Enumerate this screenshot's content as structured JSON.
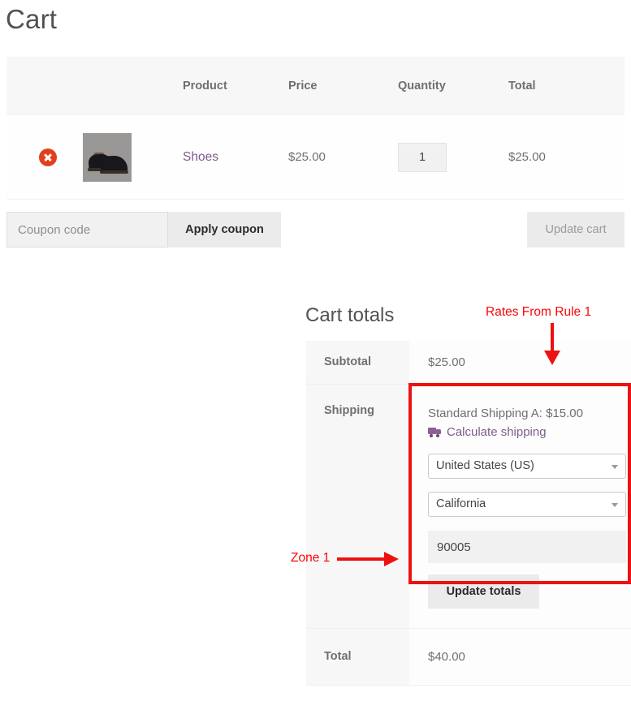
{
  "page": {
    "title": "Cart"
  },
  "cart_table": {
    "columns": [
      "",
      "",
      "Product",
      "Price",
      "Quantity",
      "Total"
    ],
    "headers": {
      "product": "Product",
      "price": "Price",
      "quantity": "Quantity",
      "total": "Total"
    },
    "rows": [
      {
        "remove_icon": "remove-circle-icon",
        "thumbnail": "product-thumbnail-shoes",
        "name": "Shoes",
        "price": "$25.00",
        "quantity": "1",
        "total": "$25.00"
      }
    ]
  },
  "coupon": {
    "placeholder": "Coupon code",
    "value": "",
    "apply_label": "Apply coupon",
    "update_cart_label": "Update cart"
  },
  "totals": {
    "title": "Cart totals",
    "subtotal_label": "Subtotal",
    "subtotal_value": "$25.00",
    "shipping_label": "Shipping",
    "shipping_method": "Standard Shipping A: $15.00",
    "calculate_link": "Calculate shipping",
    "country": "United States (US)",
    "state": "California",
    "postcode": "90005",
    "update_totals_label": "Update totals",
    "total_label": "Total",
    "total_value": "$40.00"
  },
  "annotations": {
    "rates_label": "Rates From Rule 1",
    "zone_label": "Zone 1",
    "color": "#ee1111"
  }
}
